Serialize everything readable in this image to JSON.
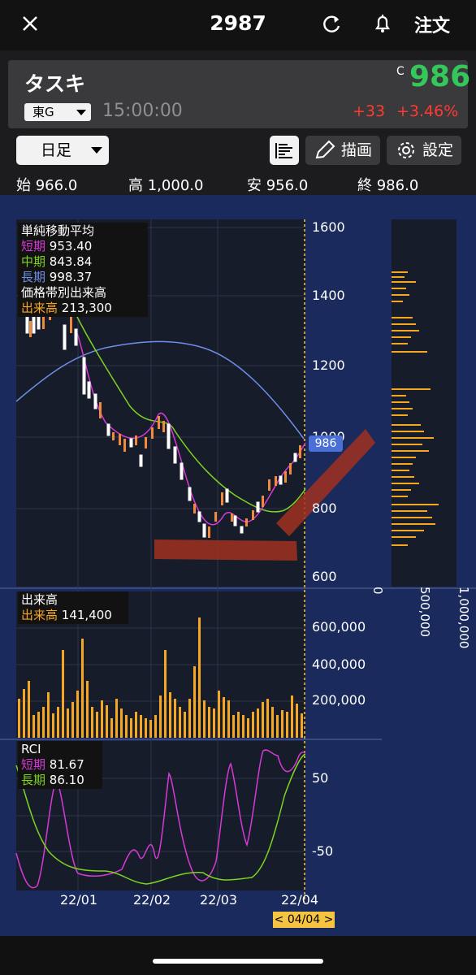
{
  "header": {
    "title": "2987",
    "order_label": "注文"
  },
  "stock": {
    "name": "タスキ",
    "market": "東G",
    "time": "15:00:00",
    "price_flag": "C",
    "price": "986",
    "change": "+33",
    "change_pct": "+3.46%"
  },
  "toolbar": {
    "period": "日足",
    "draw_label": "描画",
    "settings_label": "設定"
  },
  "ohlc": {
    "open_label": "始",
    "open": "966.0",
    "high_label": "高",
    "high": "1,000.0",
    "low_label": "安",
    "low": "956.0",
    "close_label": "終",
    "close": "986.0"
  },
  "main_legend": {
    "title": "単純移動平均",
    "short_label": "短期",
    "short_value": "953.40",
    "mid_label": "中期",
    "mid_value": "843.84",
    "long_label": "長期",
    "long_value": "998.37",
    "vp_title": "価格帯別出来高",
    "vp_label": "出来高",
    "vp_value": "213,300"
  },
  "price_axis": [
    "1600",
    "1400",
    "1200",
    "1000",
    "800",
    "600"
  ],
  "current_price_tag": "986",
  "volume_profile_axis": [
    "0",
    "500,000",
    "1,000,000"
  ],
  "volume_legend": {
    "title": "出来高",
    "label": "出来高",
    "value": "141,400"
  },
  "volume_axis": [
    "600,000",
    "400,000",
    "200,000"
  ],
  "rci_legend": {
    "title": "RCI",
    "short_label": "短期",
    "short_value": "81.67",
    "long_label": "長期",
    "long_value": "86.10"
  },
  "rci_axis": [
    "50",
    "-50"
  ],
  "date_axis": [
    "22/01",
    "22/02",
    "22/03",
    "22/04"
  ],
  "date_badge": "< 04/04 >",
  "colors": {
    "up": "#34c759",
    "down": "#ff3b30",
    "candle_up": "#f08a3c",
    "candle_down": "#ffffff",
    "sma_short": "#d63ad6",
    "sma_mid": "#7ed321",
    "sma_long": "#6f8fe8",
    "volume": "#f5a623",
    "background": "#1b2a5c"
  }
}
